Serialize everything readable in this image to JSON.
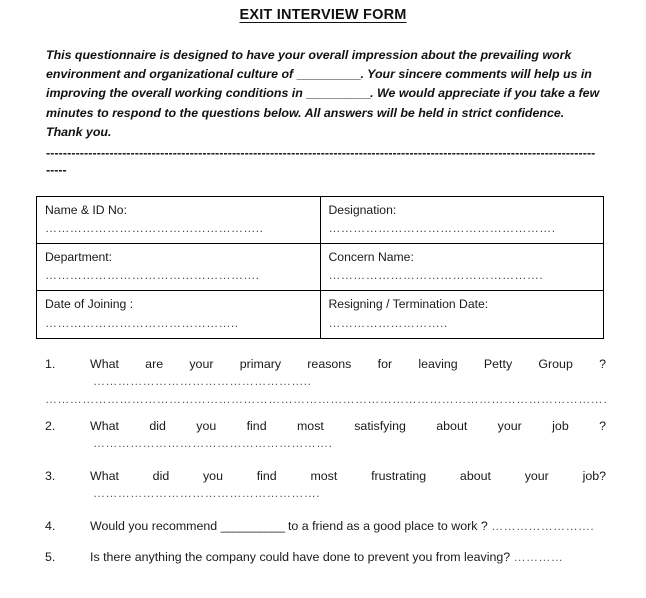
{
  "document": {
    "title": "EXIT INTERVIEW FORM",
    "intro": {
      "part1": "This questionnaire is designed to have your overall impression about the prevailing work environment and organizational culture of ",
      "blank1": "__________",
      "part2": ". Your sincere comments will help us in improving the overall working conditions in ",
      "blank2": "__________",
      "part3": ". We would appreciate if you take a few minutes to respond to the questions below. All answers will be held in strict confidence. Thank you."
    },
    "separator_line_1": "----------------------------------------------------------------------------------------------------------------------------------",
    "separator_line_2": "-----"
  },
  "info_table": {
    "rows": [
      {
        "left": {
          "label": "Name & ID No:",
          "dots": "…………………………………………….."
        },
        "right": {
          "label": "Designation:",
          "dots": "………………………………………………."
        }
      },
      {
        "left": {
          "label": "Department:",
          "dots": "……………………………………………."
        },
        "right": {
          "label": "Concern Name:",
          "dots": "……………………………………………."
        }
      },
      {
        "left": {
          "label": "Date of Joining :",
          "dots": "……………………………………….."
        },
        "right": {
          "label": "Resigning / Termination Date:",
          "dots": "……………………….."
        }
      }
    ]
  },
  "questions": [
    {
      "number": "1.",
      "text": "What are your primary reasons for leaving Petty Group ?",
      "dots": "……………………………………………..",
      "extra_dots": "……………………………………………………………………………………………………………………………………………………………"
    },
    {
      "number": "2.",
      "text": "What did you find most satisfying about your job ?",
      "dots": "…………………………………………………."
    },
    {
      "number": "3.",
      "text": "What did you find most frustrating about your job?",
      "dots": "………………………………………………."
    },
    {
      "number": "4.",
      "text_before": "Would you recommend ",
      "blank": "__________",
      "text_after": " to a friend as a good place to work ? ",
      "tail_dots": "……………………."
    },
    {
      "number": "5.",
      "text": "Is there anything the company could have done to prevent you from leaving?  ",
      "tail_dots": "…………"
    }
  ]
}
